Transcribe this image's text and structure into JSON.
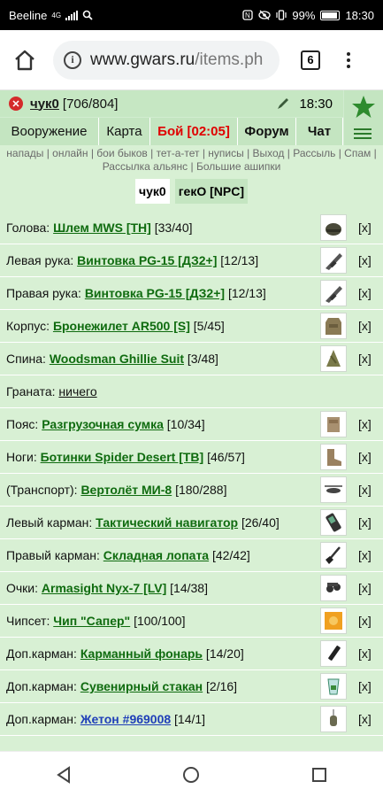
{
  "status_bar": {
    "carrier": "Beeline",
    "net": "4G",
    "battery": "99%",
    "time": "18:30"
  },
  "browser": {
    "url_host": "www.gwars.ru",
    "url_path": "/items.ph",
    "tab_count": "6"
  },
  "header": {
    "nick": "чук0",
    "hp": "[706/804]",
    "time": "18:30",
    "nav": [
      {
        "label": "Вооружение"
      },
      {
        "label": "Карта"
      },
      {
        "label": "Бой [02:05]"
      },
      {
        "label": "Форум"
      },
      {
        "label": "Чат"
      }
    ]
  },
  "links": {
    "line1": "напады | онлайн | бои быков | тет-а-тет | нуписы | Выход | Рассыль | Спам |",
    "line2": "Рассылка альянс | Большие ашипки"
  },
  "tabs": [
    {
      "label": "чук0"
    },
    {
      "label": "гекО [NPC]"
    }
  ],
  "slots": [
    {
      "label": "Голова: ",
      "item": "Шлем MWS [TH]",
      "value": " [33/40]",
      "icon": "helmet-icon"
    },
    {
      "label": "Левая рука: ",
      "item": "Винтовка PG-15 [ДЗ2+]",
      "value": " [12/13]",
      "icon": "rifle-icon"
    },
    {
      "label": "Правая рука: ",
      "item": "Винтовка PG-15 [ДЗ2+]",
      "value": " [12/13]",
      "icon": "rifle-icon"
    },
    {
      "label": "Корпус: ",
      "item": "Бронежилет AR500 [S]",
      "value": " [5/45]",
      "icon": "vest-icon"
    },
    {
      "label": "Спина: ",
      "item": "Woodsman Ghillie Suit",
      "value": " [3/48]",
      "icon": "ghillie-icon"
    },
    {
      "label": "Граната: ",
      "empty": "ничего"
    },
    {
      "label": "Пояс: ",
      "item": "Разгрузочная сумка",
      "value": " [10/34]",
      "icon": "belt-bag-icon"
    },
    {
      "label": "Ноги: ",
      "item": "Ботинки Spider Desert [TB]",
      "value": " [46/57]",
      "icon": "boots-icon"
    },
    {
      "label": "(Транспорт): ",
      "item": "Вертолёт МИ-8",
      "value": " [180/288]",
      "icon": "helicopter-icon"
    },
    {
      "label": "Левый карман: ",
      "item": "Тактический навигатор",
      "value": " [26/40]",
      "icon": "navigator-icon"
    },
    {
      "label": "Правый карман: ",
      "item": "Складная лопата",
      "value": " [42/42]",
      "icon": "shovel-icon"
    },
    {
      "label": "Очки: ",
      "item": "Armasight Nyx-7 [LV]",
      "value": " [14/38]",
      "icon": "goggles-icon"
    },
    {
      "label": "Чипсет: ",
      "item": "Чип \"Сапер\"",
      "value": " [100/100]",
      "icon": "chip-icon"
    },
    {
      "label": "Доп.карман: ",
      "item": "Карманный фонарь",
      "value": " [14/20]",
      "icon": "flashlight-icon"
    },
    {
      "label": "Доп.карман: ",
      "item": "Сувенирный стакан",
      "value": " [2/16]",
      "icon": "glass-icon"
    },
    {
      "label": "Доп.карман: ",
      "item": "Жетон #969008",
      "value": " [14/1]",
      "icon": "dogtag-icon",
      "blue": true
    }
  ],
  "remove_label": "[x]"
}
